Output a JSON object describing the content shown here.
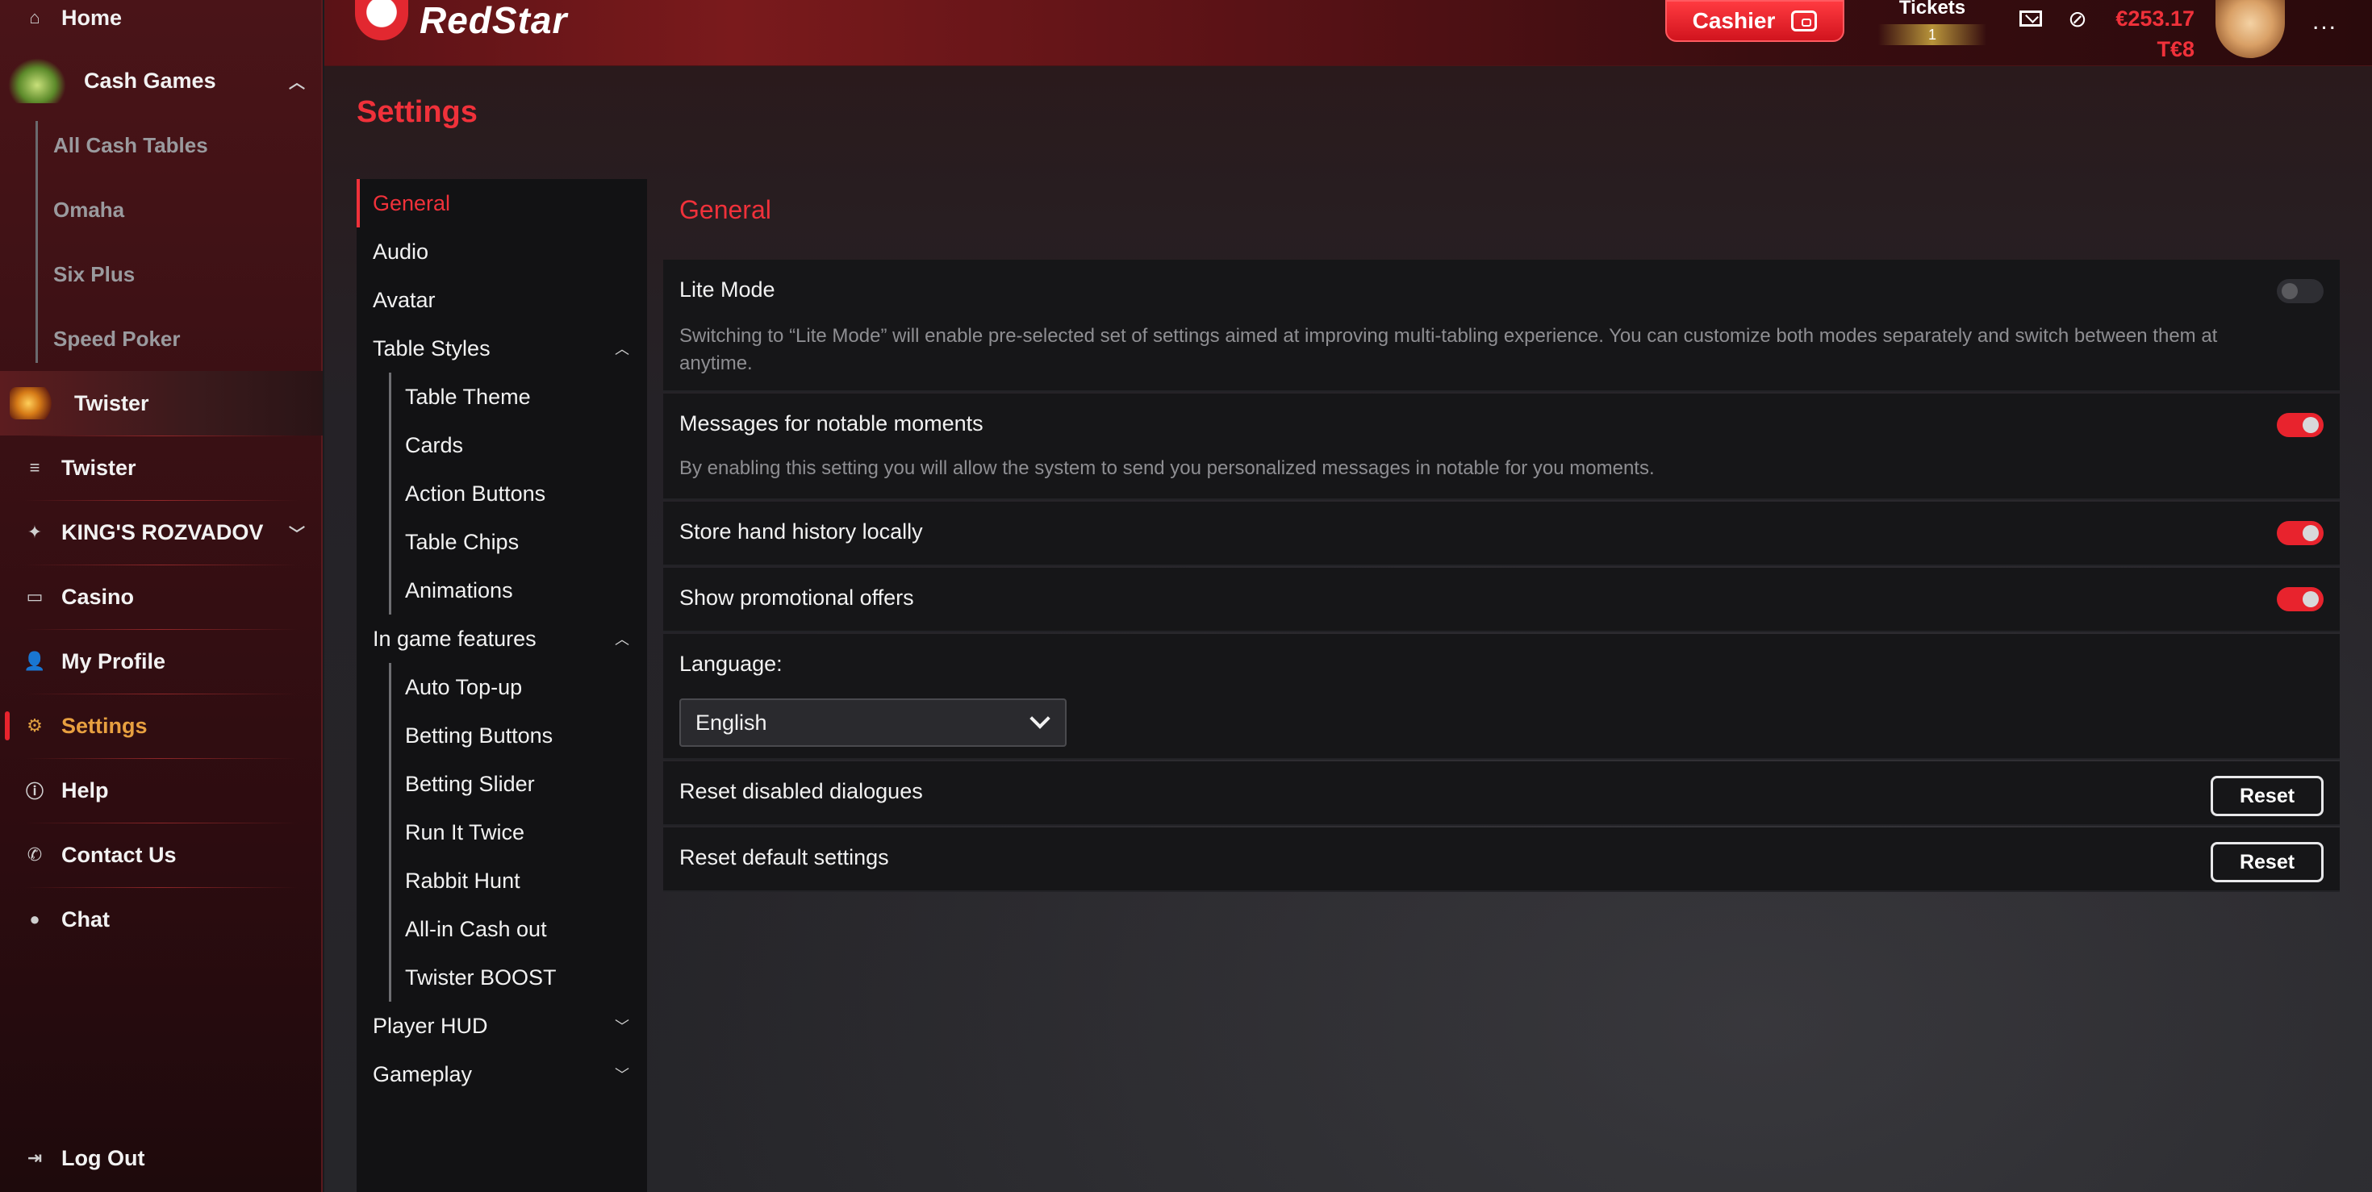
{
  "sidebar": {
    "home": "Home",
    "cash_games": "Cash Games",
    "cash_sub": [
      "All Cash Tables",
      "Omaha",
      "Six Plus",
      "Speed Poker"
    ],
    "twister_game": "Twister",
    "twister": "Twister",
    "kings": "KING'S ROZVADOV",
    "casino": "Casino",
    "my_profile": "My Profile",
    "settings": "Settings",
    "help": "Help",
    "contact_us": "Contact Us",
    "chat": "Chat",
    "log_out": "Log Out"
  },
  "topbar": {
    "logo_text": "RedStar",
    "cashier_label": "Cashier",
    "tickets_label": "Tickets",
    "tickets_count": "1",
    "balance_money": "€253.17",
    "balance_tickets": "T€8",
    "more": "..."
  },
  "page": {
    "title": "Settings"
  },
  "settings_nav": {
    "general": "General",
    "audio": "Audio",
    "avatar": "Avatar",
    "table_styles": "Table Styles",
    "table_styles_sub": [
      "Table Theme",
      "Cards",
      "Action Buttons",
      "Table Chips",
      "Animations"
    ],
    "in_game_features": "In game features",
    "in_game_sub": [
      "Auto Top-up",
      "Betting Buttons",
      "Betting Slider",
      "Run It Twice",
      "Rabbit Hunt",
      "All-in Cash out",
      "Twister BOOST"
    ],
    "player_hud": "Player HUD",
    "gameplay": "Gameplay"
  },
  "content": {
    "section_title": "General",
    "lite_mode": {
      "label": "Lite Mode",
      "desc": "Switching to “Lite Mode” will enable pre-selected set of settings aimed at improving multi-tabling experience. You can customize both modes separately and switch between them at anytime.",
      "enabled": false
    },
    "notable": {
      "label": "Messages for notable moments",
      "desc": "By enabling this setting you will allow the system to send you personalized messages in notable for you moments.",
      "enabled": true
    },
    "hand_history": {
      "label": "Store hand history locally",
      "enabled": true
    },
    "promo": {
      "label": "Show promotional offers",
      "enabled": true
    },
    "language": {
      "label": "Language:",
      "value": "English"
    },
    "reset_dialogues": {
      "label": "Reset disabled dialogues",
      "button": "Reset"
    },
    "reset_defaults": {
      "label": "Reset default settings",
      "button": "Reset"
    }
  },
  "colors": {
    "accent": "#f0313a",
    "toggle_on": "#e8232d",
    "toggle_off": "#2e2e33"
  }
}
